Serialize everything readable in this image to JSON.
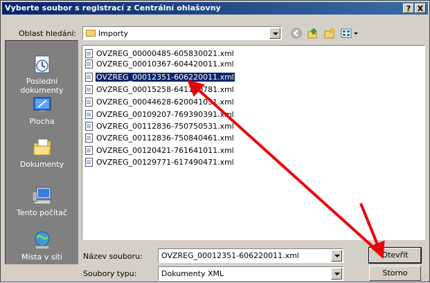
{
  "window": {
    "title": "Vyberte soubor s registrací z Centrální ohlašovny",
    "help_label": "?",
    "close_label": "X"
  },
  "lookin": {
    "label": "Oblast hledání:",
    "value": "Importy"
  },
  "places": [
    {
      "label": "Poslední dokumenty",
      "icon": "recent-documents-icon"
    },
    {
      "label": "Plocha",
      "icon": "desktop-icon"
    },
    {
      "label": "Dokumenty",
      "icon": "my-documents-icon"
    },
    {
      "label": "Tento počítač",
      "icon": "my-computer-icon"
    },
    {
      "label": "Místa v síti",
      "icon": "network-places-icon"
    }
  ],
  "files": [
    "OVZREG_00000485-605830021.xml",
    "OVZREG_00010367-604420011.xml",
    "OVZREG_00012351-606220011.xml",
    "OVZREG_00015258-641140781.xml",
    "OVZREG_00044628-620041031.xml",
    "OVZREG_00109207-769390391.xml",
    "OVZREG_00112836-750750531.xml",
    "OVZREG_00112836-750840461.xml",
    "OVZREG_00120421-761641011.xml",
    "OVZREG_00129771-617490471.xml"
  ],
  "selected_file_index": 2,
  "filename": {
    "label": "Název souboru:",
    "value": "OVZREG_00012351-606220011.xml"
  },
  "filetype": {
    "label": "Soubory typu:",
    "value": "Dokumenty XML"
  },
  "buttons": {
    "open": "Otevřít",
    "cancel": "Storno"
  },
  "annotation": {
    "arrow_color": "#e8000a"
  },
  "colors": {
    "titlebar": "#0a246a",
    "selection": "#0a246a",
    "dialog_bg": "#d4d0c8",
    "places_bg": "#808080"
  }
}
